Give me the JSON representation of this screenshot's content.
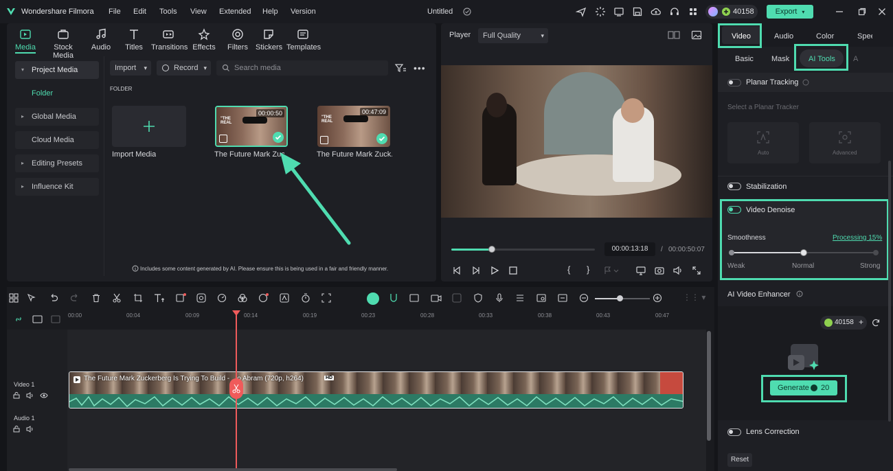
{
  "app": {
    "name": "Wondershare Filmora",
    "project_title": "Untitled",
    "credits": "40158",
    "export_label": "Export"
  },
  "menu": [
    "File",
    "Edit",
    "Tools",
    "View",
    "Extended",
    "Help",
    "Version"
  ],
  "media_tabs": [
    {
      "label": "Media",
      "icon": "media-icon"
    },
    {
      "label": "Stock Media",
      "icon": "stock-media-icon"
    },
    {
      "label": "Audio",
      "icon": "music-note-icon"
    },
    {
      "label": "Titles",
      "icon": "text-t-icon"
    },
    {
      "label": "Transitions",
      "icon": "transition-icon"
    },
    {
      "label": "Effects",
      "icon": "effects-icon"
    },
    {
      "label": "Filters",
      "icon": "filter-icon"
    },
    {
      "label": "Stickers",
      "icon": "sticker-icon"
    },
    {
      "label": "Templates",
      "icon": "template-icon"
    }
  ],
  "sidebar": {
    "items": [
      {
        "label": "Project Media",
        "expandable": true
      },
      {
        "label": "Folder",
        "active": true
      },
      {
        "label": "Global Media",
        "expandable": true
      },
      {
        "label": "Cloud Media"
      },
      {
        "label": "Editing Presets",
        "expandable": true
      },
      {
        "label": "Influence Kit",
        "expandable": true
      }
    ]
  },
  "media_toolbar": {
    "import_label": "Import",
    "record_label": "Record",
    "search_placeholder": "Search media"
  },
  "folder_label": "FOLDER",
  "media_items": [
    {
      "label": "Import Media"
    },
    {
      "label": "The Future Mark Zuck...",
      "duration": "00:00:50",
      "thumb_text": "\"THE REAL"
    },
    {
      "label": "The Future Mark Zuck...",
      "duration": "00:47:09",
      "thumb_text": "\"THE REAL"
    }
  ],
  "ai_notice": "Includes some content generated by AI. Please ensure this is being used in a fair and friendly manner.",
  "player": {
    "label": "Player",
    "quality": "Full Quality",
    "current_time": "00:00:13:18",
    "separator": "/",
    "total_time": "00:00:50:07",
    "progress": 0.28
  },
  "inspector": {
    "tabs": [
      "Video",
      "Audio",
      "Color",
      "Speed"
    ],
    "subtabs": [
      "Basic",
      "Mask",
      "AI Tools",
      "A"
    ],
    "planar_tracking": "Planar Tracking",
    "planar_placeholder": "Select a Planar Tracker",
    "tracker_auto": "Auto",
    "tracker_advanced": "Advanced",
    "stabilization": "Stabilization",
    "video_denoise": "Video Denoise",
    "smoothness": "Smoothness",
    "processing": "Processing 15%",
    "slider_labels": [
      "Weak",
      "Normal",
      "Strong"
    ],
    "smoothness_level": 0.5,
    "ai_enhancer": "AI Video Enhancer",
    "enhancer_credits": "40158",
    "generate_label": "Generate",
    "generate_cost": "20",
    "lens_correction": "Lens Correction",
    "reset_label": "Reset"
  },
  "timeline": {
    "ruler": [
      "00:00",
      "00:04",
      "00:09",
      "00:14",
      "00:19",
      "00:23",
      "00:28",
      "00:33",
      "00:38",
      "00:43",
      "00:47"
    ],
    "tracks": [
      {
        "name": "Video 1"
      },
      {
        "name": "Audio 1"
      }
    ],
    "clip_title": "The Future Mark Zuckerberg Is Trying To Build - ...o Abram (720p, h264)",
    "clip_badge": "HD"
  },
  "colors": {
    "accent": "#4fdcb0",
    "playhead": "#ef5b5b",
    "link": "#4fdcb0"
  }
}
